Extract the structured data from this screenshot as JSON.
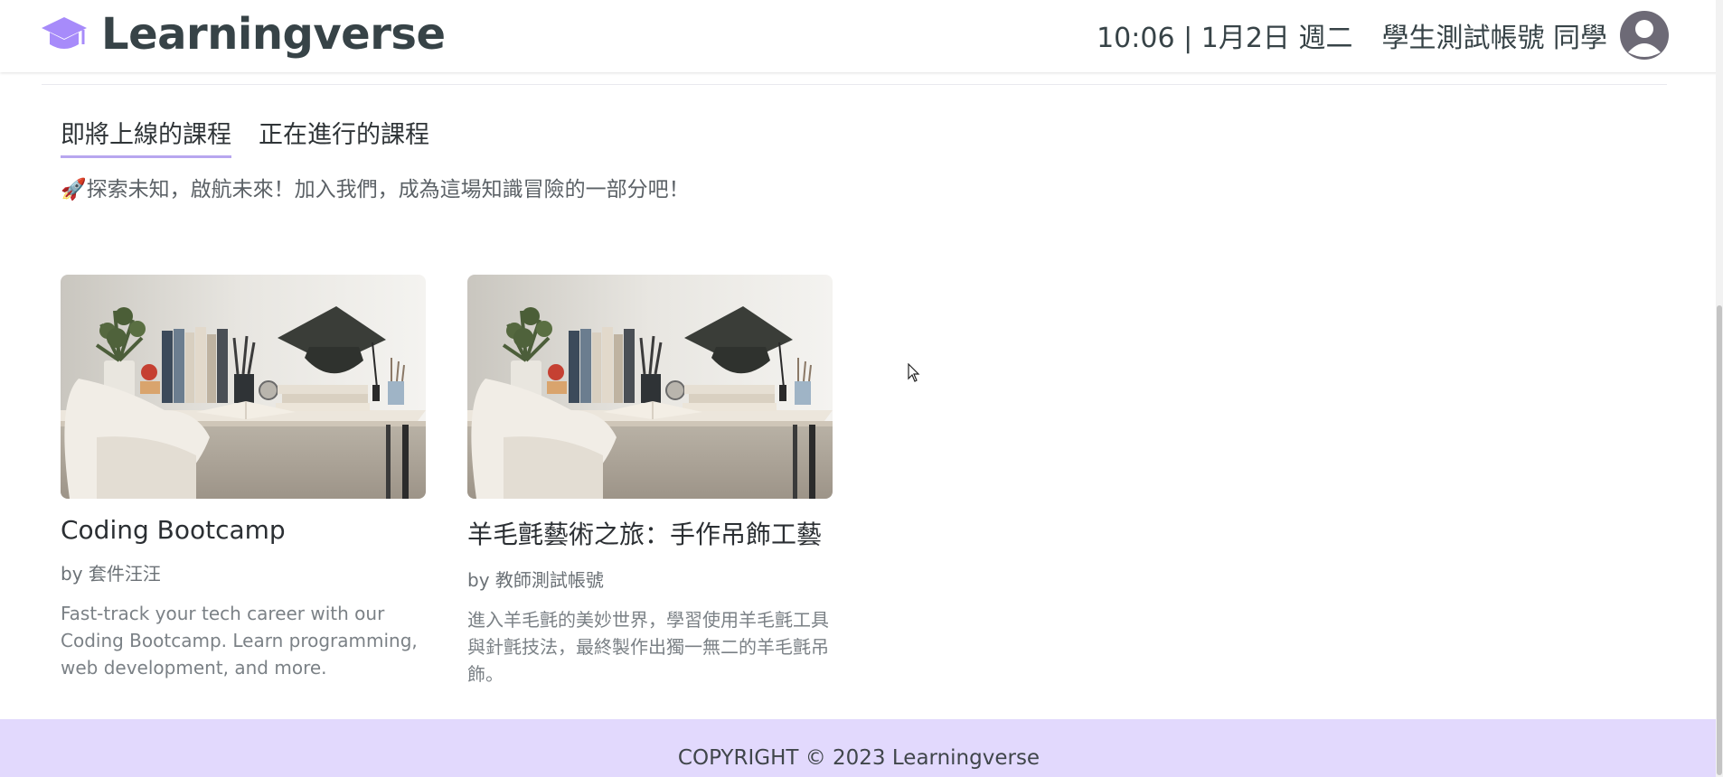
{
  "header": {
    "brand": "Learningverse",
    "datetime": "10:06 | 1月2日 週二",
    "user_name": "學生測試帳號 同學"
  },
  "tabs": [
    {
      "label": "即將上線的課程",
      "active": true
    },
    {
      "label": "正在進行的課程",
      "active": false
    }
  ],
  "tagline": "🚀探索未知，啟航未來！加入我們，成為這場知識冒險的一部分吧！",
  "courses": [
    {
      "title": "Coding Bootcamp",
      "author": "by 套件汪汪",
      "description": "Fast-track your tech career with our Coding Bootcamp. Learn programming, web development, and more."
    },
    {
      "title": "羊毛氈藝術之旅：手作吊飾工藝",
      "author": "by 教師測試帳號",
      "description": "進入羊毛氈的美妙世界，學習使用羊毛氈工具與針氈技法，最終製作出獨一無二的羊毛氈吊飾。"
    }
  ],
  "footer": {
    "copyright": "COPYRIGHT © 2023 Learningverse"
  },
  "colors": {
    "accent": "#b8a6ef",
    "brand_icon": "#a78bfa",
    "footer_bg": "#e2d9fd"
  },
  "icons": {
    "brand": "graduation-cap-icon",
    "avatar": "user-avatar-icon"
  }
}
